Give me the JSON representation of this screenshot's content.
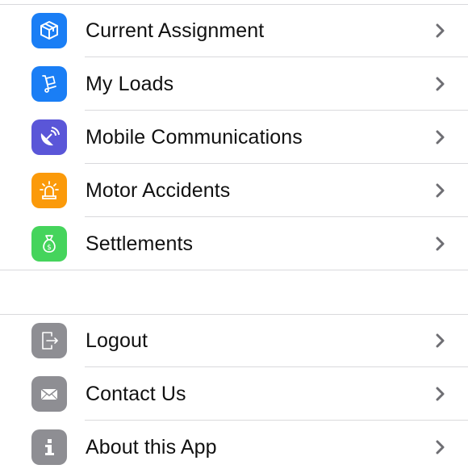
{
  "colors": {
    "blue": "#1a7ef5",
    "purple": "#5a56d8",
    "orange": "#fb9a0a",
    "green": "#45d45c",
    "gray": "#8e8e93",
    "separator": "#d9d9dc",
    "chevron": "#6e6e73"
  },
  "main_menu": {
    "items": [
      {
        "label": "Current Assignment",
        "icon": "package-box-icon",
        "icon_color": "blue"
      },
      {
        "label": "My Loads",
        "icon": "hand-truck-icon",
        "icon_color": "blue"
      },
      {
        "label": "Mobile Communications",
        "icon": "satellite-dish-icon",
        "icon_color": "purple"
      },
      {
        "label": "Motor Accidents",
        "icon": "emergency-siren-icon",
        "icon_color": "orange"
      },
      {
        "label": "Settlements",
        "icon": "money-bag-icon",
        "icon_color": "green"
      }
    ]
  },
  "secondary_menu": {
    "items": [
      {
        "label": "Logout",
        "icon": "exit-door-icon",
        "icon_color": "gray"
      },
      {
        "label": "Contact Us",
        "icon": "envelope-icon",
        "icon_color": "gray"
      },
      {
        "label": "About this App",
        "icon": "info-icon",
        "icon_color": "gray"
      }
    ]
  }
}
